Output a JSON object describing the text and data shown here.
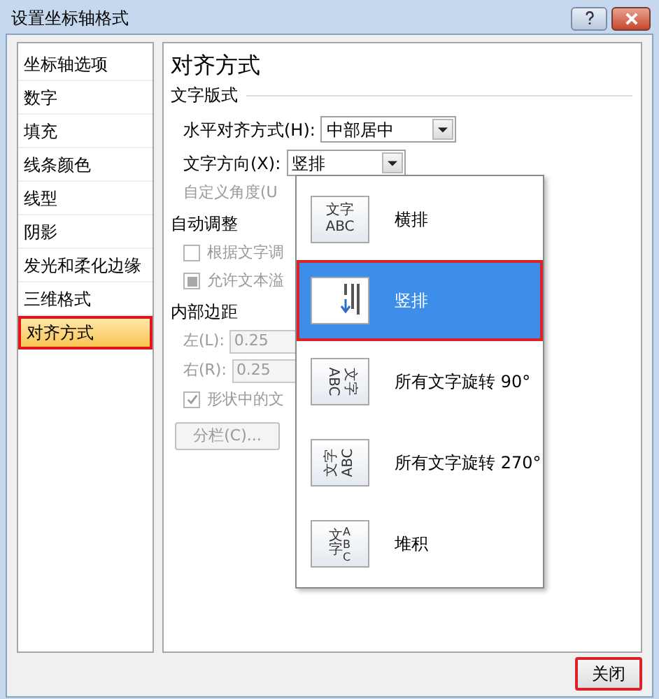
{
  "window": {
    "title": "设置坐标轴格式"
  },
  "sidebar": {
    "items": [
      {
        "label": "坐标轴选项",
        "selected": false
      },
      {
        "label": "数字",
        "selected": false
      },
      {
        "label": "填充",
        "selected": false
      },
      {
        "label": "线条颜色",
        "selected": false
      },
      {
        "label": "线型",
        "selected": false
      },
      {
        "label": "阴影",
        "selected": false
      },
      {
        "label": "发光和柔化边缘",
        "selected": false
      },
      {
        "label": "三维格式",
        "selected": false
      },
      {
        "label": "对齐方式",
        "selected": true
      }
    ]
  },
  "panel": {
    "heading": "对齐方式",
    "section": "文字版式",
    "horizontal": {
      "label": "水平对齐方式(H):",
      "value": "中部居中"
    },
    "direction": {
      "label": "文字方向(X):",
      "value": "竖排"
    },
    "angle_label": "自定义角度(U",
    "autofit": {
      "title": "自动调整",
      "checkboxes": [
        {
          "label": "根据文字调",
          "checked": false,
          "indeterminate": false,
          "disabled": true
        },
        {
          "label": "允许文本溢",
          "checked": false,
          "indeterminate": true,
          "disabled": true
        }
      ]
    },
    "margins": {
      "title": "内部边距",
      "fields": [
        {
          "label": "左(L):",
          "value": "0.25"
        },
        {
          "label": "右(R):",
          "value": "0.25"
        }
      ],
      "wrap": {
        "label": "形状中的文",
        "checked": true,
        "disabled": true
      },
      "columns_button": "分栏(C)..."
    }
  },
  "direction_menu": {
    "options": [
      {
        "kind": "horizontal",
        "icon_text": [
          "文字",
          "ABC"
        ],
        "label": "横排",
        "selected": false
      },
      {
        "kind": "vertical",
        "label": "竖排",
        "selected": true
      },
      {
        "kind": "rotate90",
        "icon_text": [
          "文字",
          "ABC"
        ],
        "label": "所有文字旋转 90°",
        "selected": false
      },
      {
        "kind": "rotate270",
        "icon_text": [
          "文字",
          "ABC"
        ],
        "label": "所有文字旋转 270°",
        "selected": false
      },
      {
        "kind": "stacked",
        "icon_text": [
          "文字",
          "ABC"
        ],
        "label": "堆积",
        "selected": false
      }
    ]
  },
  "close_button": {
    "label": "关闭",
    "highlighted": true
  }
}
